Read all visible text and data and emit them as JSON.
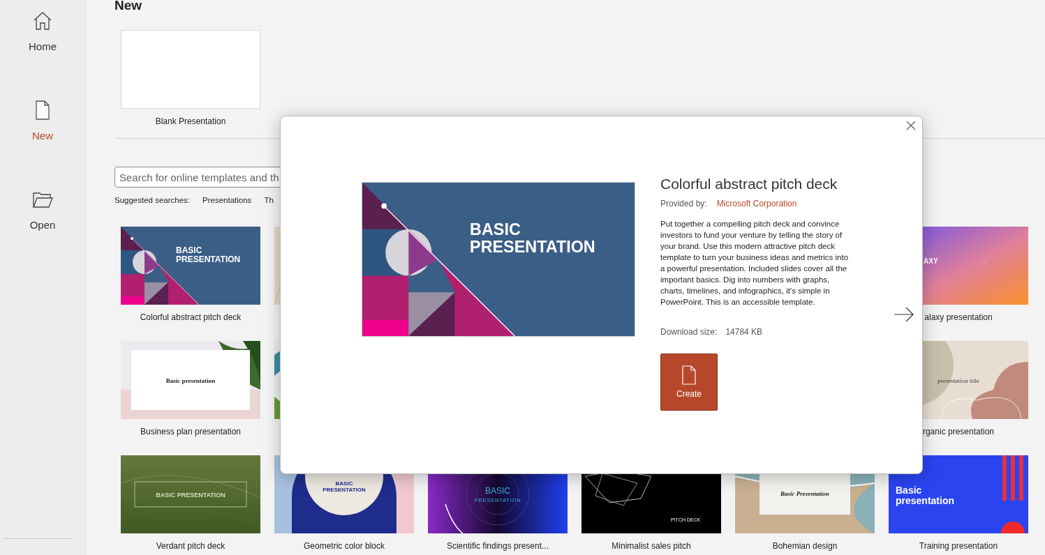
{
  "sidebar": {
    "items": [
      {
        "label": "Home",
        "selected": false
      },
      {
        "label": "New",
        "selected": true
      },
      {
        "label": "Open",
        "selected": false
      }
    ]
  },
  "page": {
    "heading": "New",
    "blank": {
      "title": "Blank Presentation"
    },
    "search": {
      "placeholder": "Search for online templates and th"
    },
    "suggested": {
      "label": "Suggested searches:",
      "items": [
        "Presentations",
        "Th"
      ]
    }
  },
  "templates": [
    {
      "kind": "abstract",
      "title": "Colorful abstract pitch deck",
      "slide_text": [
        "BASIC",
        "PRESENTATION"
      ]
    },
    {
      "kind": "sand"
    },
    {
      "kind": "hidden"
    },
    {
      "kind": "hidden"
    },
    {
      "kind": "hidden"
    },
    {
      "kind": "galaxy",
      "title": "alaxy presentation",
      "slide_text": [
        "AXY"
      ]
    },
    {
      "kind": "plan",
      "title": "Business plan presentation",
      "slide_text": [
        "Basic presentation"
      ]
    },
    {
      "kind": "teal"
    },
    {
      "kind": "hidden"
    },
    {
      "kind": "hidden"
    },
    {
      "kind": "hidden"
    },
    {
      "kind": "organic",
      "title": "rganic presentation",
      "slide_text": [
        "presentation title"
      ]
    },
    {
      "kind": "verdant",
      "title": "Verdant pitch deck",
      "slide_text": [
        "BASIC PRESENTATION"
      ]
    },
    {
      "kind": "geometric",
      "title": "Geometric color block",
      "slide_text": [
        "BASIC",
        "PRESENTATION"
      ]
    },
    {
      "kind": "scientific",
      "title": "Scientific findings present...",
      "slide_text": [
        "BASIC",
        "PRESENTATION"
      ]
    },
    {
      "kind": "minimalist",
      "title": "Minimalist sales pitch",
      "slide_text": [
        "PITCH DECK"
      ]
    },
    {
      "kind": "bohemian",
      "title": "Bohemian design",
      "slide_text": [
        "Basic Presentation"
      ]
    },
    {
      "kind": "training",
      "title": "Training presentation",
      "slide_text": [
        "Basic",
        "presentation"
      ]
    }
  ],
  "dialog": {
    "preview": {
      "kind": "abstract",
      "slide_text": [
        "BASIC",
        "PRESENTATION"
      ]
    },
    "title": "Colorful abstract pitch deck",
    "provider_label": "Provided by:",
    "provider": "Microsoft Corporation",
    "description": "Put together a compelling pitch deck and convince investors to fund your venture by telling the story of your brand. Use this modern attractive pitch deck template to turn your business ideas and metrics into a powerful presentation. Included slides cover all the important basics. Dig into numbers with graphs, charts, timelines, and infographics, it's simple in PowerPoint. This is an accessible template.",
    "size_label": "Download size:",
    "size": "14784 KB",
    "create": "Create"
  }
}
